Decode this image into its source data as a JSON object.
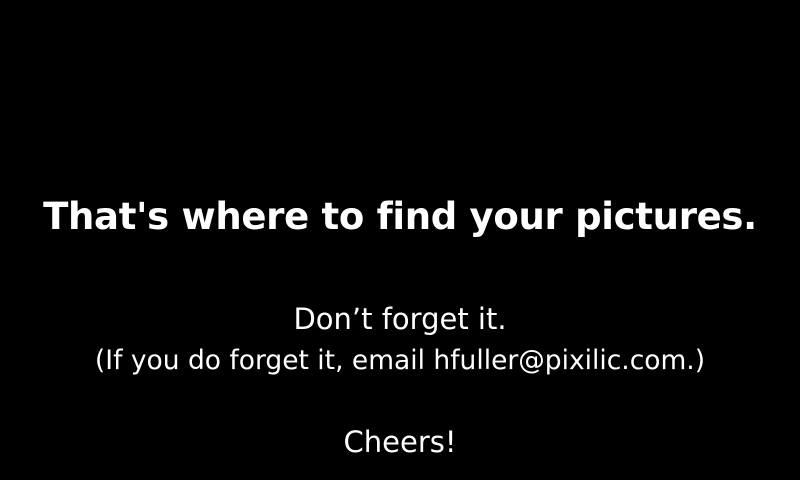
{
  "message": {
    "headline": "That's where to find your pictures.",
    "reminder": "Don’t forget it.",
    "fallback": "(If you do forget it, email hfuller@pixilic.com.)",
    "signoff": "Cheers!"
  },
  "colors": {
    "background": "#000000",
    "text": "#ffffff"
  }
}
